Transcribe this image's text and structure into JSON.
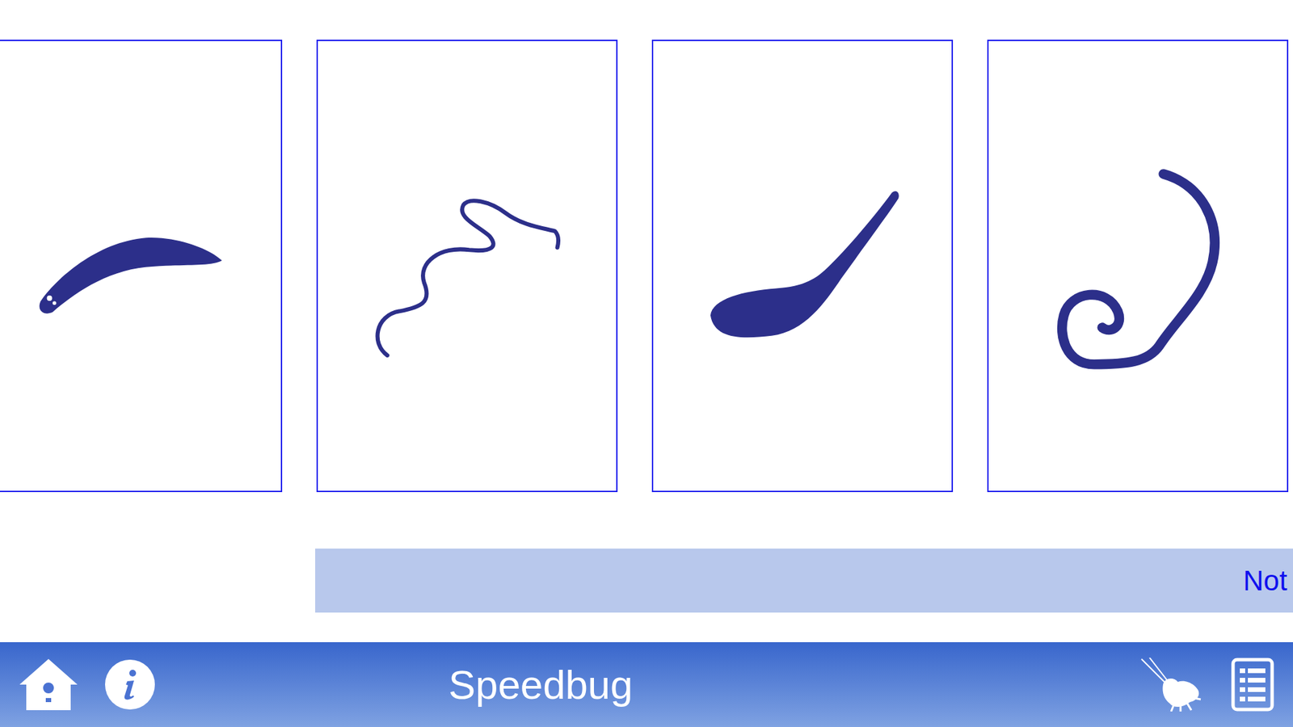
{
  "hint_bar": {
    "text": "Not"
  },
  "app_bar": {
    "title": "Speedbug"
  }
}
